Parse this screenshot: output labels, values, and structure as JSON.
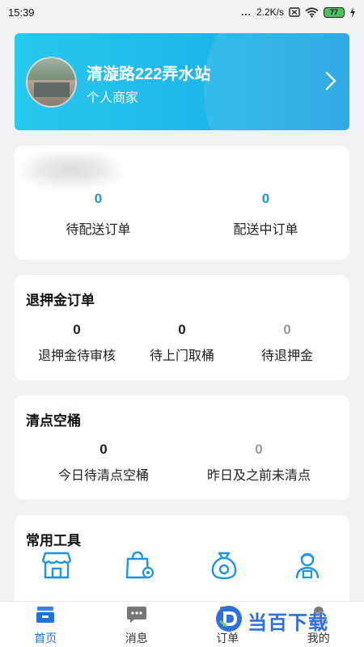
{
  "status_bar": {
    "time": "15:39",
    "dots": "...",
    "speed": "2.2K/s",
    "battery": "77"
  },
  "store": {
    "name": "清漩路222弄水站",
    "type": "个人商家"
  },
  "delivery": {
    "pending_count": "0",
    "pending_label": "待配送订单",
    "in_progress_count": "0",
    "in_progress_label": "配送中订单"
  },
  "refund": {
    "title": "退押金订单",
    "items": [
      {
        "count": "0",
        "label": "退押金待审核"
      },
      {
        "count": "0",
        "label": "待上门取桶"
      },
      {
        "count": "0",
        "label": "待退押金"
      }
    ]
  },
  "buckets": {
    "title": "清点空桶",
    "items": [
      {
        "count": "0",
        "label": "今日待清点空桶"
      },
      {
        "count": "0",
        "label": "昨日及之前未清点"
      }
    ]
  },
  "tools": {
    "title": "常用工具",
    "icons": [
      "store-icon",
      "bag-settings-icon",
      "money-bag-icon",
      "delivery-person-icon"
    ]
  },
  "tab_bar": {
    "tabs": [
      {
        "label": "首页",
        "icon": "home-icon"
      },
      {
        "label": "消息",
        "icon": "message-icon"
      },
      {
        "label": "订单",
        "icon": "order-icon"
      },
      {
        "label": "我的",
        "icon": "profile-icon"
      }
    ],
    "watermark": "当百下载"
  },
  "colors": {
    "accent": "#1e93e8",
    "tab_active": "#1e6fe0",
    "banner_start": "#27c9ee",
    "banner_end": "#1aa0e2"
  }
}
